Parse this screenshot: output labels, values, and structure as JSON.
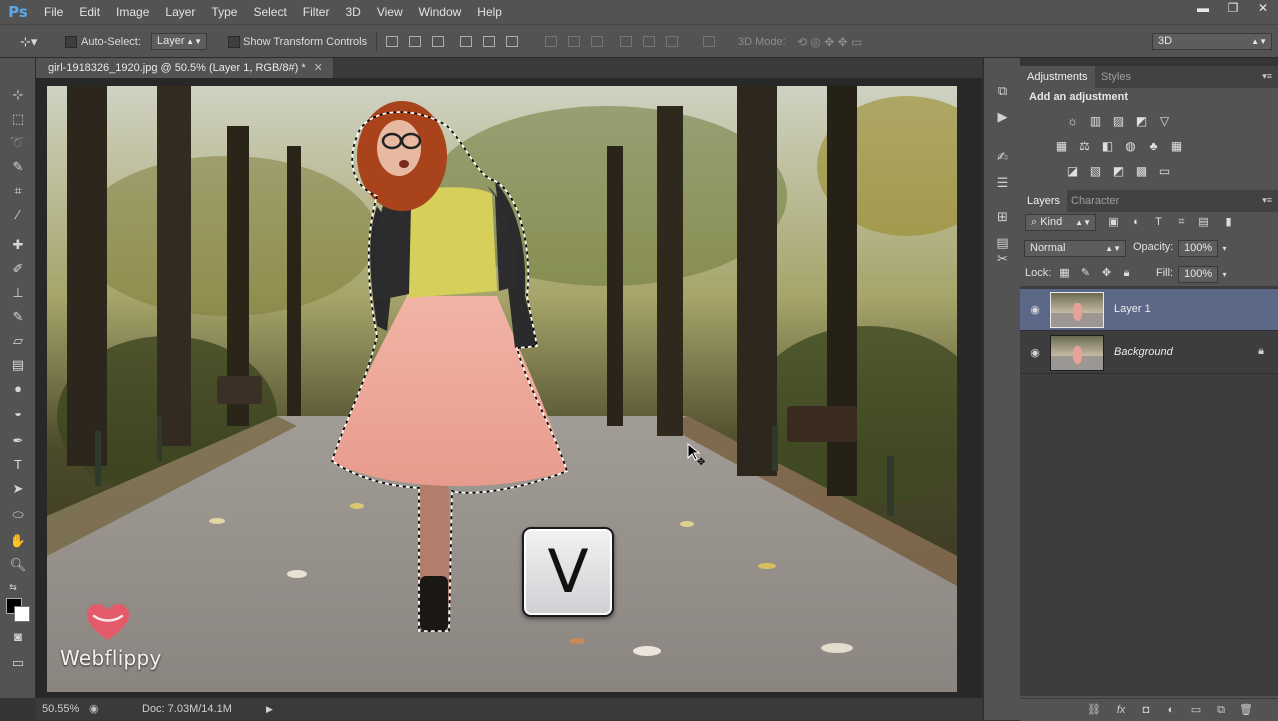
{
  "app": {
    "logo": "Ps",
    "menu": [
      "File",
      "Edit",
      "Image",
      "Layer",
      "Type",
      "Select",
      "Filter",
      "3D",
      "View",
      "Window",
      "Help"
    ],
    "window_controls": [
      "▬",
      "❐",
      "✕"
    ]
  },
  "options_bar": {
    "auto_select_label": "Auto-Select:",
    "auto_select_value": "Layer",
    "transform_label": "Show Transform Controls",
    "mode_label": "3D Mode:",
    "workspace_value": "3D"
  },
  "document": {
    "tab_title": "girl-1918326_1920.jpg @ 50.5% (Layer 1, RGB/8#) *",
    "close_glyph": "✕"
  },
  "overlay": {
    "key": "V",
    "watermark": "Webflippy"
  },
  "status": {
    "zoom": "50.55%",
    "doc_info": "Doc: 7.03M/14.1M"
  },
  "panels": {
    "adjustments": {
      "tabs": [
        "Adjustments",
        "Styles"
      ],
      "heading": "Add an adjustment"
    },
    "layers": {
      "tabs": [
        "Layers",
        "Character"
      ],
      "filter_label": "Kind",
      "blend_mode": "Normal",
      "opacity_label": "Opacity:",
      "opacity_value": "100%",
      "lock_label": "Lock:",
      "fill_label": "Fill:",
      "fill_value": "100%",
      "items": [
        {
          "name": "Layer 1",
          "selected": true,
          "locked": false
        },
        {
          "name": "Background",
          "selected": false,
          "locked": true
        }
      ]
    }
  },
  "colors": {
    "ui_bg": "#535353",
    "selected_layer": "#5b6888",
    "logo": "#5aa7e8"
  }
}
